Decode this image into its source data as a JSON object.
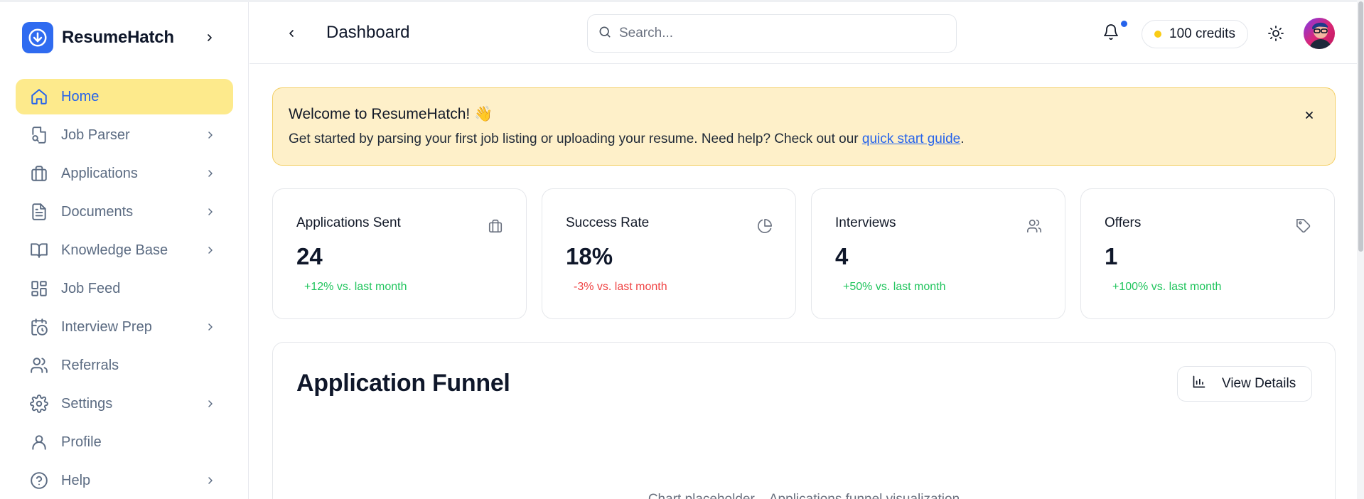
{
  "app": {
    "name": "ResumeHatch"
  },
  "sidebar": {
    "items": [
      {
        "label": "Home",
        "icon": "home-icon",
        "active": true,
        "has_children": false
      },
      {
        "label": "Job Parser",
        "icon": "file-search-icon",
        "active": false,
        "has_children": true
      },
      {
        "label": "Applications",
        "icon": "briefcase-icon",
        "active": false,
        "has_children": true
      },
      {
        "label": "Documents",
        "icon": "document-icon",
        "active": false,
        "has_children": true
      },
      {
        "label": "Knowledge Base",
        "icon": "book-icon",
        "active": false,
        "has_children": true
      },
      {
        "label": "Job Feed",
        "icon": "layout-grid-icon",
        "active": false,
        "has_children": false
      },
      {
        "label": "Interview Prep",
        "icon": "calendar-clock-icon",
        "active": false,
        "has_children": true
      },
      {
        "label": "Referrals",
        "icon": "users-icon",
        "active": false,
        "has_children": false
      },
      {
        "label": "Settings",
        "icon": "gear-icon",
        "active": false,
        "has_children": true
      },
      {
        "label": "Profile",
        "icon": "user-icon",
        "active": false,
        "has_children": false
      },
      {
        "label": "Help",
        "icon": "help-circle-icon",
        "active": false,
        "has_children": true
      }
    ]
  },
  "header": {
    "title": "Dashboard",
    "search_placeholder": "Search...",
    "credits": "100 credits"
  },
  "banner": {
    "title": "Welcome to ResumeHatch! 👋",
    "text_before_link": "Get started by parsing your first job listing or uploading your resume. Need help? Check out our ",
    "link_text": "quick start guide",
    "text_after_link": "."
  },
  "stats": [
    {
      "title": "Applications Sent",
      "value": "24",
      "change": "+12% vs. last month",
      "trend": "up",
      "icon": "briefcase-icon"
    },
    {
      "title": "Success Rate",
      "value": "18%",
      "change": "-3% vs. last month",
      "trend": "down",
      "icon": "pie-chart-icon"
    },
    {
      "title": "Interviews",
      "value": "4",
      "change": "+50% vs. last month",
      "trend": "up",
      "icon": "users-icon"
    },
    {
      "title": "Offers",
      "value": "1",
      "change": "+100% vs. last month",
      "trend": "up",
      "icon": "tag-icon"
    }
  ],
  "funnel": {
    "title": "Application Funnel",
    "button_label": "View Details",
    "empty_text": "Chart placeholder – Applications funnel visualization"
  },
  "colors": {
    "accent": "#2563eb",
    "active_nav_bg": "#fdea8c",
    "banner_bg": "#fef0c9",
    "positive": "#22c55e",
    "negative": "#ef4444"
  }
}
